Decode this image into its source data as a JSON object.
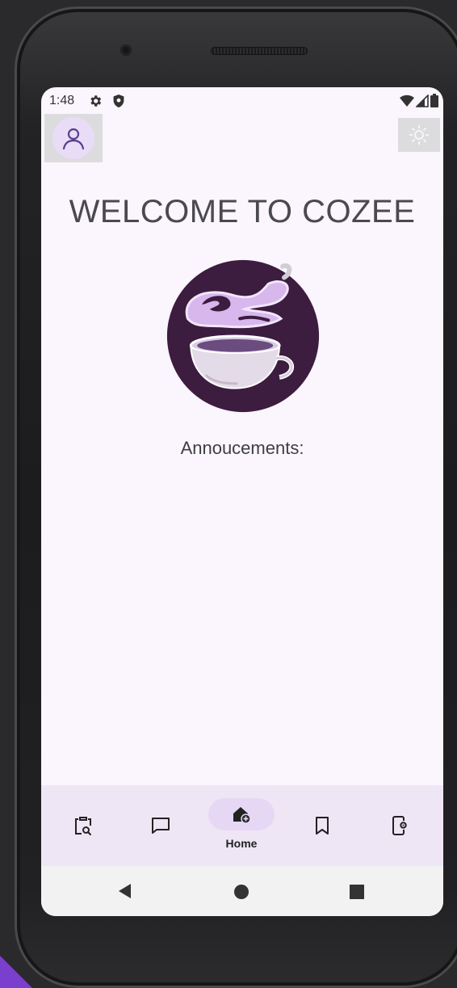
{
  "status_bar": {
    "time": "1:48",
    "left_icons": [
      "settings-icon",
      "shield-icon"
    ],
    "right_icons": [
      "wifi-icon",
      "signal-icon",
      "battery-icon"
    ]
  },
  "header": {
    "profile_icon": "profile-icon",
    "theme_icon": "sun-icon"
  },
  "main": {
    "welcome_title": "WELCOME TO COZEE",
    "logo_icon": "cozee-coffee-cup-logo",
    "announcements_label": "Annoucements:"
  },
  "bottom_nav": {
    "items": [
      {
        "icon": "clipboard-search-icon",
        "label": ""
      },
      {
        "icon": "chat-bubble-icon",
        "label": ""
      },
      {
        "icon": "home-add-icon",
        "label": "Home",
        "active": true
      },
      {
        "icon": "bookmark-icon",
        "label": ""
      },
      {
        "icon": "phone-settings-icon",
        "label": ""
      }
    ]
  },
  "system_nav": {
    "buttons": [
      "back-icon",
      "home-circle-icon",
      "recents-square-icon"
    ]
  },
  "colors": {
    "screen_background": "#fbf5fd",
    "nav_background": "#efe6f5",
    "active_pill": "#e6d8f4",
    "logo_dark": "#3c1c3f",
    "logo_light": "#d7b7ec"
  }
}
